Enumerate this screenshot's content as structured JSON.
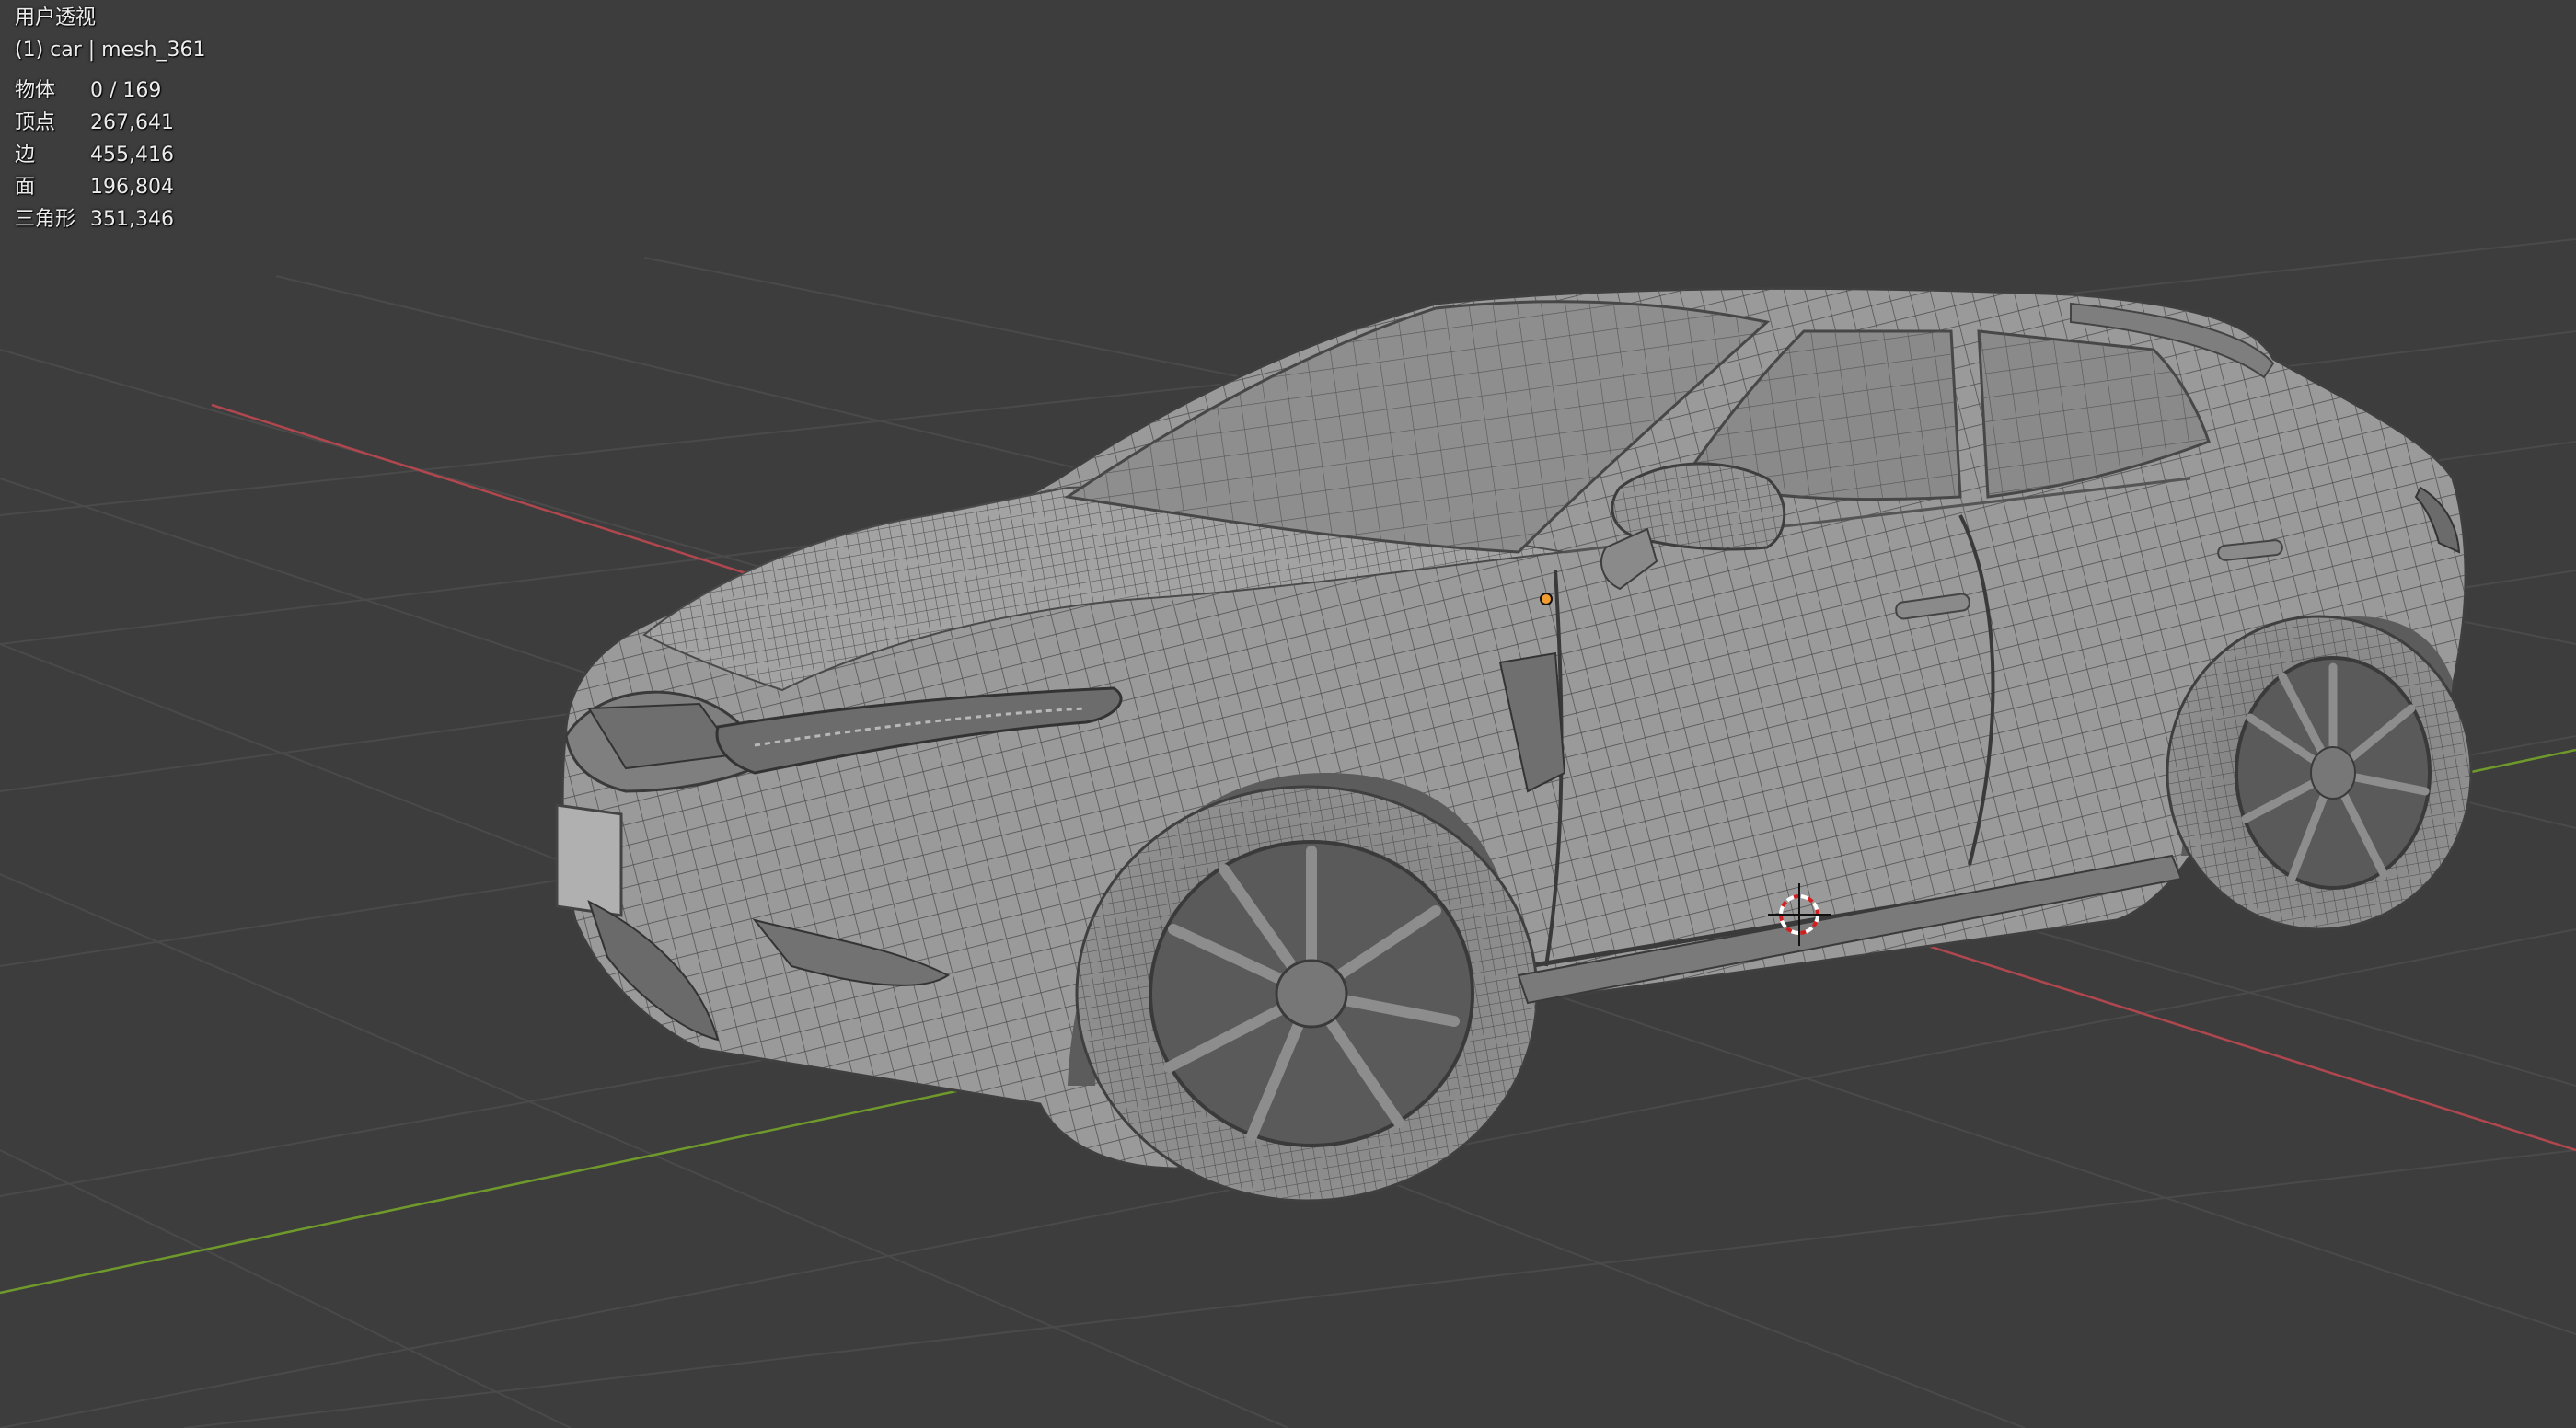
{
  "viewport": {
    "view_mode": "用户透视",
    "active_object": "(1) car | mesh_361",
    "stats": [
      {
        "label": "物体",
        "value": "0 / 169"
      },
      {
        "label": "顶点",
        "value": "267,641"
      },
      {
        "label": "边",
        "value": "455,416"
      },
      {
        "label": "面",
        "value": "196,804"
      },
      {
        "label": "三角形",
        "value": "351,346"
      }
    ]
  },
  "colors": {
    "background": "#3d3d3d",
    "grid_line": "#4a4a4a",
    "x_axis": "#b0474f",
    "y_axis": "#6f9a2b",
    "mesh_body": "#9a9a9a",
    "mesh_wire": "#4a4a4a",
    "origin_dot": "#f29b30",
    "cursor_red": "#d21e1e"
  },
  "icons": [
    "3d-cursor-icon",
    "object-origin-icon"
  ]
}
